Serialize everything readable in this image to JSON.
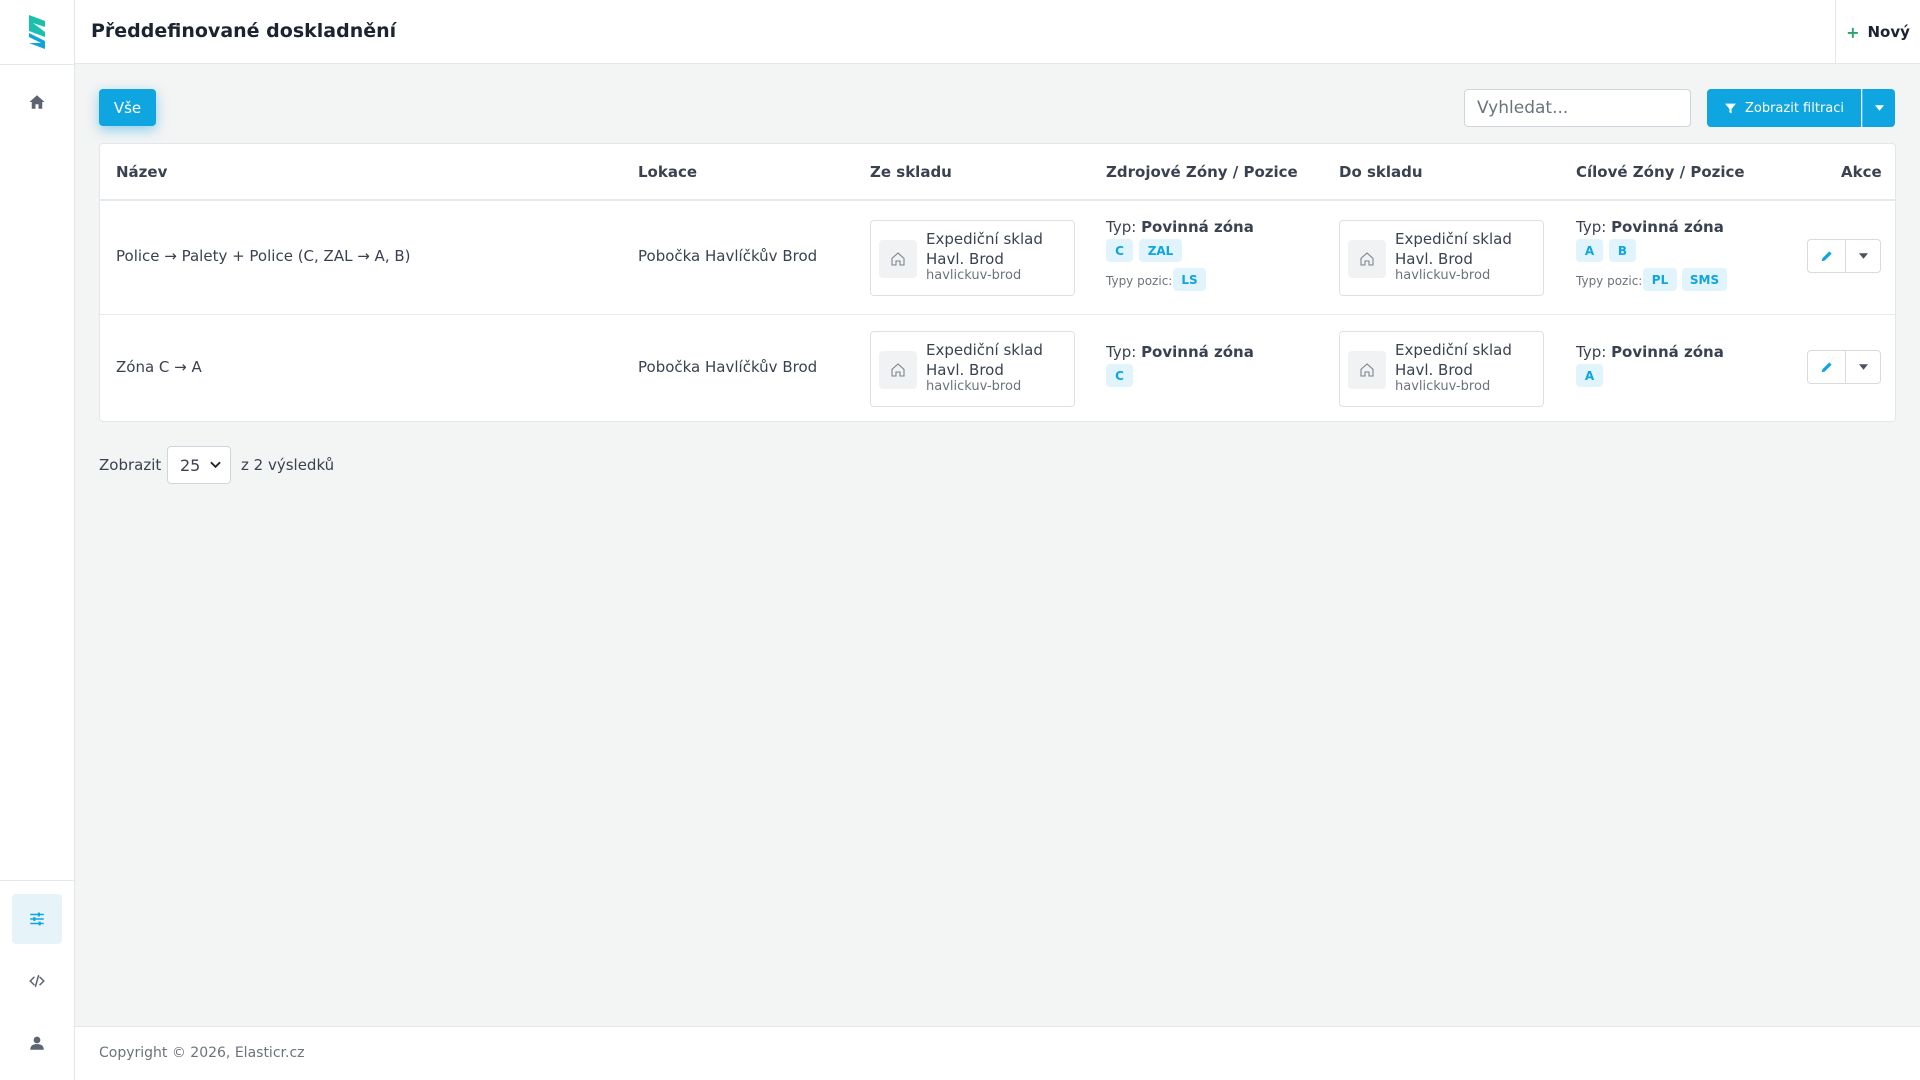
{
  "header": {
    "title": "Předdefinované doskladnění",
    "new_label": "Nový"
  },
  "sidebar": {
    "items": [
      {
        "icon": "home-icon"
      },
      {
        "icon": "sliders-icon",
        "active": true
      },
      {
        "icon": "code-icon"
      },
      {
        "icon": "user-icon"
      }
    ]
  },
  "toolbar": {
    "all_label": "Vše",
    "search_placeholder": "Vyhledat...",
    "filter_label": "Zobrazit filtraci"
  },
  "table": {
    "columns": [
      "Název",
      "Lokace",
      "Ze skladu",
      "Zdrojové Zóny / Pozice",
      "Do skladu",
      "Cílové Zóny / Pozice",
      "Akce"
    ],
    "rows": [
      {
        "name": "Police → Palety + Police (C, ZAL → A, B)",
        "location": "Pobočka Havlíčkův Brod",
        "from_warehouse": {
          "name": "Expediční sklad Havl. Brod",
          "code": "havlickuv-brod"
        },
        "source": {
          "typ_label": "Typ:",
          "typ": "Povinná zóna",
          "zones": [
            "C",
            "ZAL"
          ],
          "positions_label": "Typy pozic:",
          "positions": [
            "LS"
          ]
        },
        "to_warehouse": {
          "name": "Expediční sklad Havl. Brod",
          "code": "havlickuv-brod"
        },
        "target": {
          "typ_label": "Typ:",
          "typ": "Povinná zóna",
          "zones": [
            "A",
            "B"
          ],
          "positions_label": "Typy pozic:",
          "positions": [
            "PL",
            "SMS"
          ]
        }
      },
      {
        "name": "Zóna C → A",
        "location": "Pobočka Havlíčkův Brod",
        "from_warehouse": {
          "name": "Expediční sklad Havl. Brod",
          "code": "havlickuv-brod"
        },
        "source": {
          "typ_label": "Typ:",
          "typ": "Povinná zóna",
          "zones": [
            "C"
          ]
        },
        "to_warehouse": {
          "name": "Expediční sklad Havl. Brod",
          "code": "havlickuv-brod"
        },
        "target": {
          "typ_label": "Typ:",
          "typ": "Povinná zóna",
          "zones": [
            "A"
          ]
        }
      }
    ]
  },
  "pagination": {
    "show_label": "Zobrazit",
    "page_size": "25",
    "results_label": "z 2 výsledků"
  },
  "footer": {
    "copyright": "Copyright © 2026, Elasticr.cz"
  },
  "colors": {
    "accent": "#0ea5e0",
    "badge_bg": "#e1f3fb",
    "logo": "#1bbfae"
  }
}
